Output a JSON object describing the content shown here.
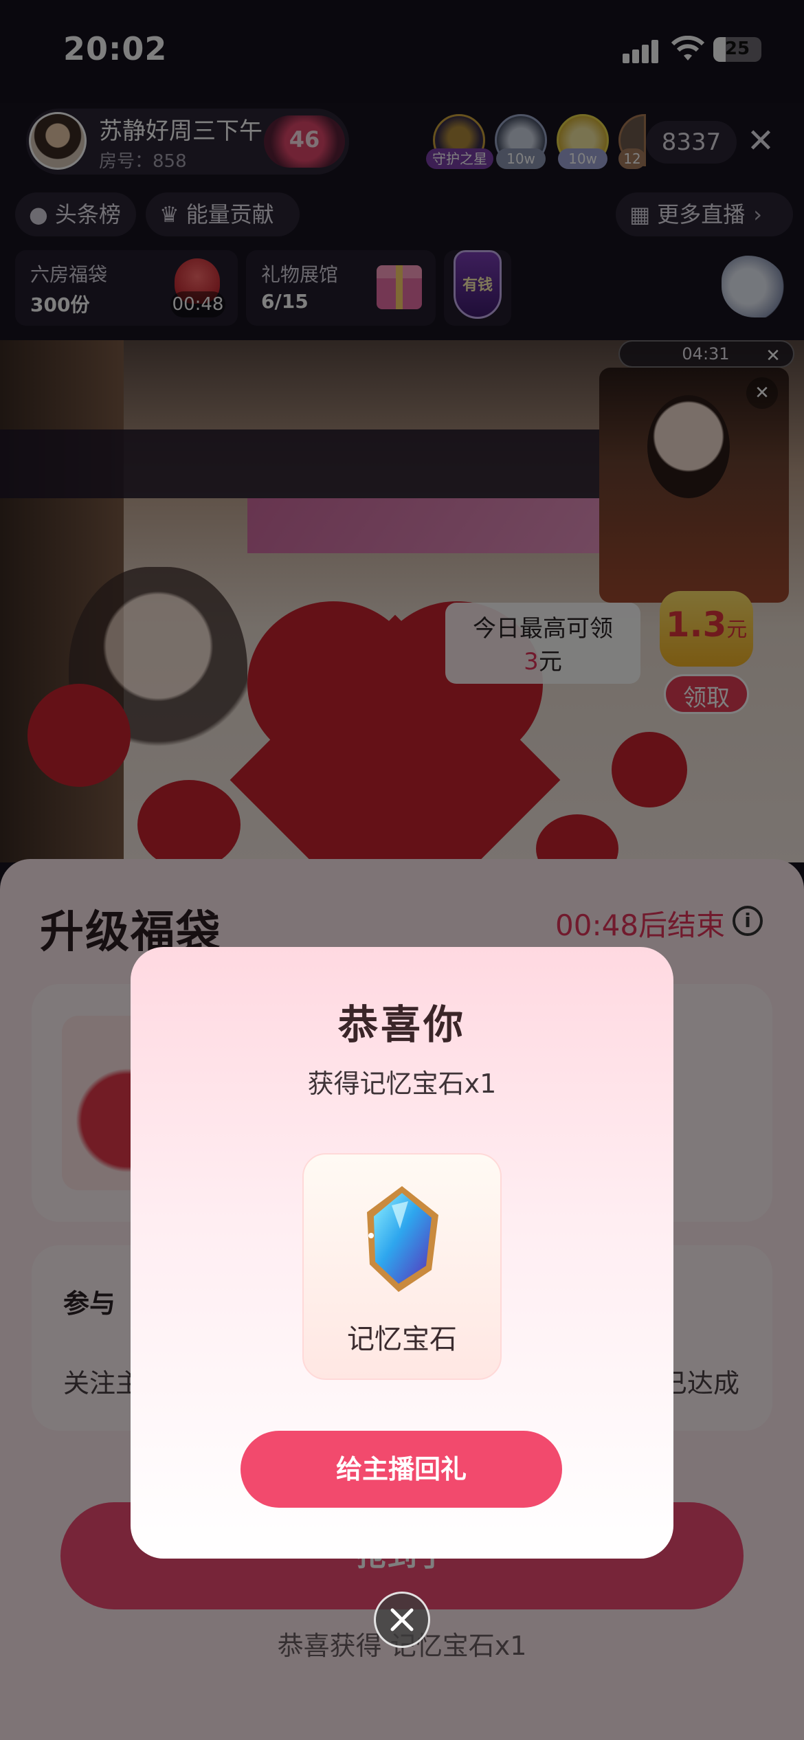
{
  "status_bar": {
    "time": "20:02",
    "battery": "25",
    "icons": [
      "signal-icon",
      "wifi-icon",
      "battery-icon"
    ]
  },
  "header": {
    "host_name": "苏静好周三下午",
    "room_number": "房号：858",
    "heart_level": "46",
    "viewers": [
      {
        "tag": "守护之星"
      },
      {
        "tag": "10w"
      },
      {
        "tag": "10w"
      },
      {
        "tag": "12"
      }
    ],
    "viewer_count": "8337"
  },
  "chips": {
    "headline_rank": "头条榜",
    "energy_contribution": "能量贡献",
    "more_live": "更多直播"
  },
  "info_cards": {
    "lucky_bag_title": "六房福袋",
    "lucky_bag_count": "300份",
    "lucky_bag_timer": "00:48",
    "gift_hall_title": "礼物展馆",
    "gift_hall_progress": "6/15",
    "badge_text": "有钱"
  },
  "stream": {
    "pip_timer": "04:31",
    "reward_tip_line1": "今日最高可领",
    "reward_tip_amount": "3",
    "reward_tip_unit": "元",
    "reward_value": "1.3",
    "reward_value_unit": "元",
    "claim_label": "领取"
  },
  "sheet": {
    "title": "升级福袋",
    "timer": "00:48后结束",
    "participate_label": "参与",
    "follow_label": "关注主",
    "achieved_label": "已达成",
    "grab_label": "抢到了",
    "congrats_line": "恭喜获得 记忆宝石x1"
  },
  "modal": {
    "title": "恭喜你",
    "subtitle": "获得记忆宝石x1",
    "prize_name": "记忆宝石",
    "return_gift_label": "给主播回礼"
  },
  "colors": {
    "accent_pink": "#f24a6d",
    "timer_red": "#e2345b",
    "dark_bg": "#16131f"
  }
}
